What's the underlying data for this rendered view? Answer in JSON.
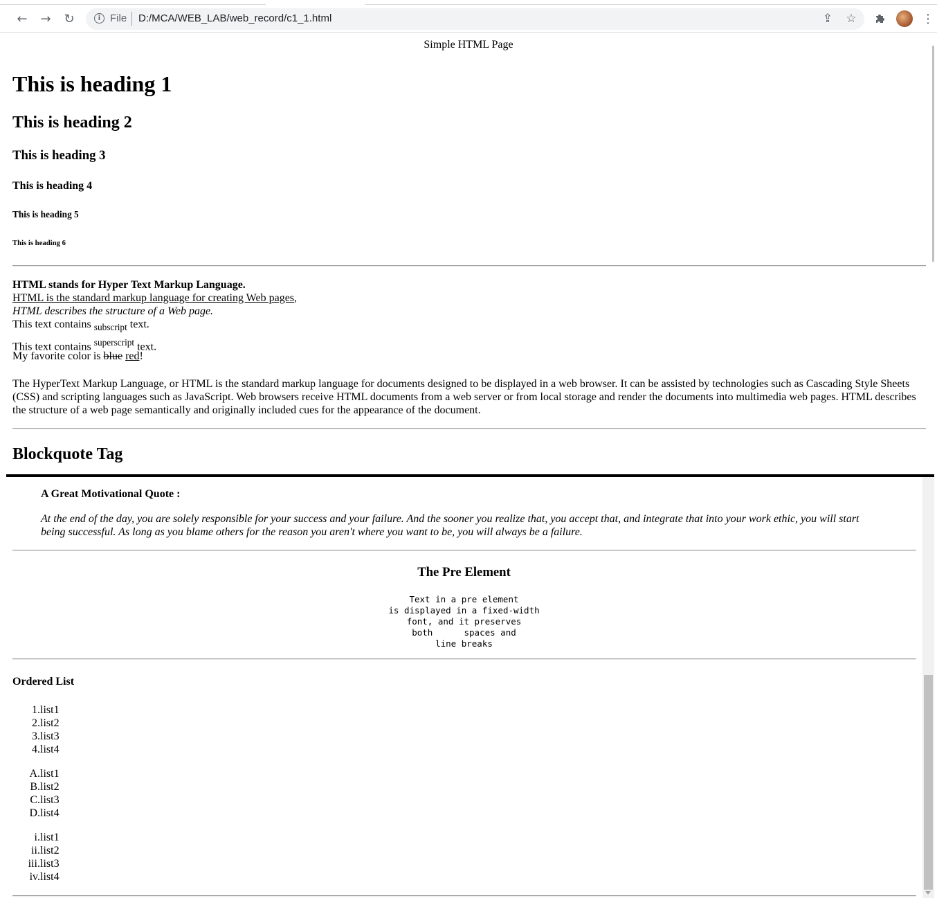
{
  "browser": {
    "file_label": "File",
    "url": "D:/MCA/WEB_LAB/web_record/c1_1.html"
  },
  "page": {
    "title": "Simple HTML Page",
    "h1": "This is heading 1",
    "h2": "This is heading 2",
    "h3": "This is heading 3",
    "h4": "This is heading 4",
    "h5": "This is heading 5",
    "h6": "This is heading 6",
    "bold_line": "HTML stands for Hyper Text Markup Language.",
    "underline_line": "HTML is the standard markup language for creating Web pages",
    "underline_comma": ",",
    "italic_line": "HTML describes the structure of a Web page.",
    "sub_pre": "This text contains ",
    "sub_text": "subscript",
    "sub_post": " text.",
    "sup_pre": "This text contains ",
    "sup_text": "superscript",
    "sup_post": " text.",
    "color_pre": "My favorite color is ",
    "color_del": "blue",
    "color_ins": "red",
    "color_post": "!",
    "paragraph": "The HyperText Markup Language, or HTML is the standard markup language for documents designed to be displayed in a web browser. It can be assisted by technologies such as Cascading Style Sheets (CSS) and scripting languages such as JavaScript. Web browsers receive HTML documents from a web server or from local storage and render the documents into multimedia web pages. HTML describes the structure of a web page semantically and originally included cues for the appearance of the document.",
    "blockquote_heading": "Blockquote Tag",
    "quote_heading": "A Great Motivational Quote :",
    "quote_text": "At the end of the day, you are solely responsible for your success and your failure. And the sooner you realize that, you accept that, and integrate that into your work ethic, you will start being successful. As long as you blame others for the reason you aren't where you want to be, you will always be a failure.",
    "pre_title": "The Pre Element",
    "pre_text": "Text in a pre element\nis displayed in a fixed-width\nfont, and it preserves\nboth      spaces and\nline breaks",
    "ordered_list_title": "Ordered List",
    "list_numeric": [
      {
        "m": "1.",
        "t": "list1"
      },
      {
        "m": "2.",
        "t": "list2"
      },
      {
        "m": "3.",
        "t": "list3"
      },
      {
        "m": "4.",
        "t": "list4"
      }
    ],
    "list_alpha": [
      {
        "m": "A.",
        "t": "list1"
      },
      {
        "m": "B.",
        "t": "list2"
      },
      {
        "m": "C.",
        "t": "list3"
      },
      {
        "m": "D.",
        "t": "list4"
      }
    ],
    "list_roman": [
      {
        "m": "i.",
        "t": "list1"
      },
      {
        "m": "ii.",
        "t": "list2"
      },
      {
        "m": "iii.",
        "t": "list3"
      },
      {
        "m": "iv.",
        "t": "list4"
      }
    ]
  }
}
